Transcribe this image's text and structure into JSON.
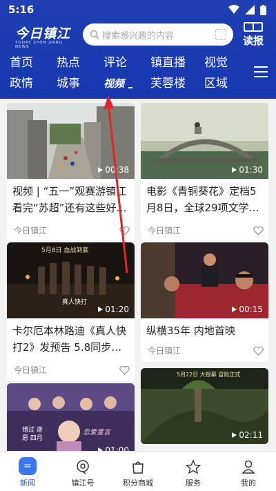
{
  "status": {
    "time": "5:16"
  },
  "header": {
    "logo_main": "今日镇江",
    "logo_sub": "TODAY ZHEN JIANG NEWS",
    "search_placeholder": "搜索感兴趣的内容",
    "read_label": "读报"
  },
  "nav": {
    "row1": [
      "首页",
      "热点",
      "评论",
      "镇直播",
      "视觉"
    ],
    "row2": [
      "政情",
      "城事",
      "视频",
      "芙蓉楼",
      "区域"
    ],
    "active": "视频"
  },
  "cards": [
    {
      "title": "视频 | “五一”观赛游镇江 看完“苏超”还有这些好…",
      "source": "今日镇江",
      "duration": "00:38"
    },
    {
      "title": "电影《青铜葵花》定档5月8日，全球29项文学…",
      "source": "今日镇江",
      "duration": "01:30"
    },
    {
      "title": "卡尔厄本林路迪《真人快打2》发预告 5.8同步…",
      "source": "今日镇江",
      "duration": "01:20",
      "overlay_left": "真人快打",
      "overlay_top": "5月8日 血战到底"
    },
    {
      "title": "纵横35年 内地首映",
      "source": "今日镇江",
      "duration": "00:15"
    },
    {
      "title": "",
      "source": "",
      "duration": "01:00",
      "overlay_a": "恋爱宣言",
      "overlay_b": "错过 遂愿 四月"
    },
    {
      "title": "",
      "source": "",
      "duration": "02:11",
      "overlay_a": "5月22日 大银幕 冒险正式"
    }
  ],
  "tabs": [
    {
      "label": "新闻",
      "active": true
    },
    {
      "label": "镇江号",
      "active": false
    },
    {
      "label": "积分商城",
      "active": false
    },
    {
      "label": "服务",
      "active": false
    },
    {
      "label": "我的",
      "active": false
    }
  ],
  "colors": {
    "header": "#1b3cb0",
    "accent": "#3b76f0",
    "annotation": "#e0262b"
  }
}
